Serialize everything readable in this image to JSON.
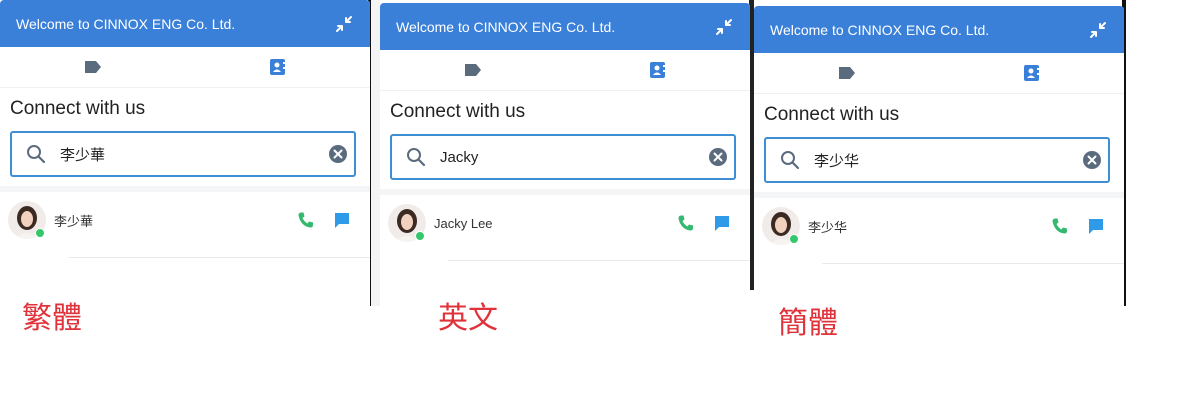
{
  "panels": [
    {
      "header_title": "Welcome to CINNOX ENG Co. Ltd.",
      "connect_title": "Connect with us",
      "search_value": "李少華",
      "contact_name": "李少華",
      "caption": "繁體"
    },
    {
      "header_title": "Welcome to CINNOX ENG Co. Ltd.",
      "connect_title": "Connect with us",
      "search_value": "Jacky",
      "contact_name": "Jacky Lee",
      "caption": "英文"
    },
    {
      "header_title": "Welcome to CINNOX ENG Co. Ltd.",
      "connect_title": "Connect with us",
      "search_value": "李少华",
      "contact_name": "李少华",
      "caption": "簡體"
    }
  ],
  "colors": {
    "header": "#3a7fd8",
    "search_border": "#3d8ed3",
    "call_icon": "#35b86f",
    "chat_icon": "#2f9be8",
    "caption": "#e0323a",
    "online": "#35c76b"
  },
  "icons": [
    "minimize-icon",
    "tag-icon",
    "contacts-icon",
    "search-icon",
    "clear-icon",
    "phone-icon",
    "chat-icon"
  ]
}
